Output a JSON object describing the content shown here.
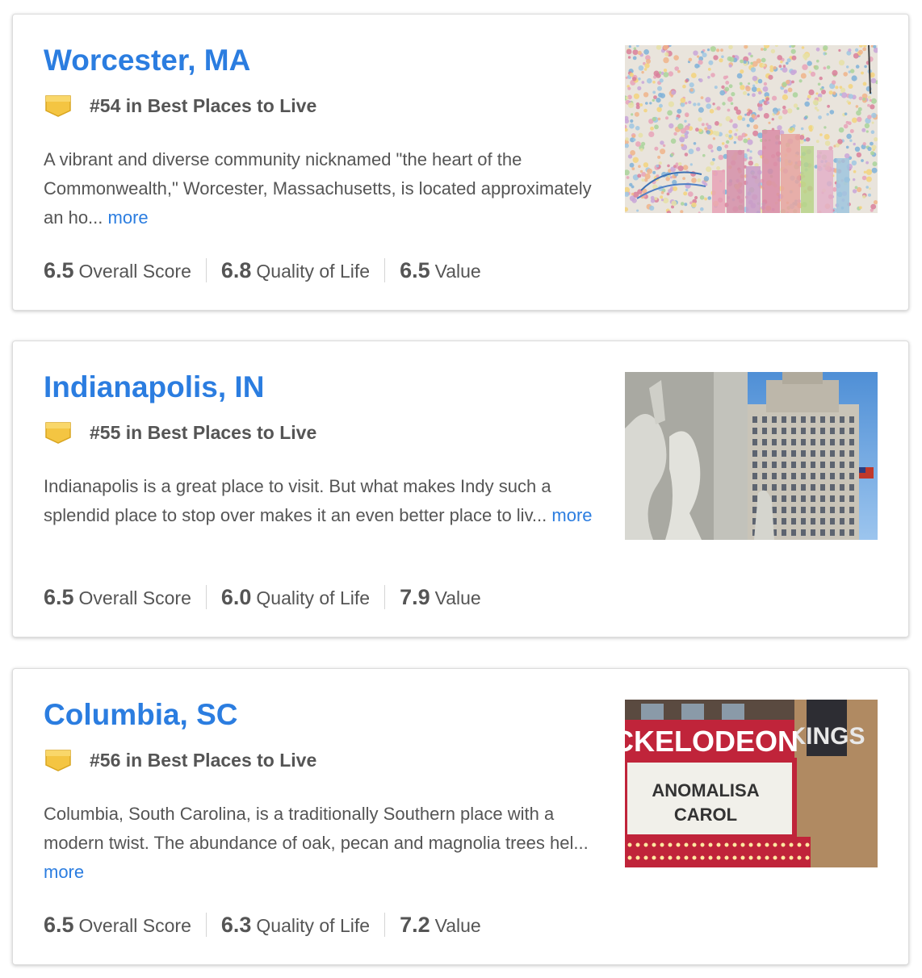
{
  "listings": [
    {
      "title": "Worcester, MA",
      "rank": "#54 in Best Places to Live",
      "description": "A vibrant and diverse community nicknamed \"the heart of the Commonwealth,\" Worcester, Massachusetts, is located approximately an ho...",
      "more": "more",
      "scores": [
        {
          "value": "6.5",
          "label": "Overall Score"
        },
        {
          "value": "6.8",
          "label": "Quality of Life"
        },
        {
          "value": "6.5",
          "label": "Value"
        }
      ]
    },
    {
      "title": "Indianapolis, IN",
      "rank": "#55 in Best Places to Live",
      "description": "Indianapolis is a great place to visit. But what makes Indy such a splendid place to stop over makes it an even better place to liv...",
      "more": "more",
      "scores": [
        {
          "value": "6.5",
          "label": "Overall Score"
        },
        {
          "value": "6.0",
          "label": "Quality of Life"
        },
        {
          "value": "7.9",
          "label": "Value"
        }
      ]
    },
    {
      "title": "Columbia, SC",
      "rank": "#56 in Best Places to Live",
      "description": "Columbia, South Carolina, is a traditionally Southern place with a modern twist. The abundance of oak, pecan and magnolia trees hel...",
      "more": "more",
      "scores": [
        {
          "value": "6.5",
          "label": "Overall Score"
        },
        {
          "value": "6.3",
          "label": "Quality of Life"
        },
        {
          "value": "7.2",
          "label": "Value"
        }
      ],
      "photo_text": {
        "marquee_top": "CKELODEON",
        "sign_right": "KINGS",
        "line1": "ANOMALISA",
        "line2": "CAROL"
      }
    }
  ],
  "colors": {
    "link": "#2b7de0",
    "text": "#555555",
    "badge": "#f4c542"
  },
  "icons": {
    "rank_badge": "badge-icon"
  }
}
